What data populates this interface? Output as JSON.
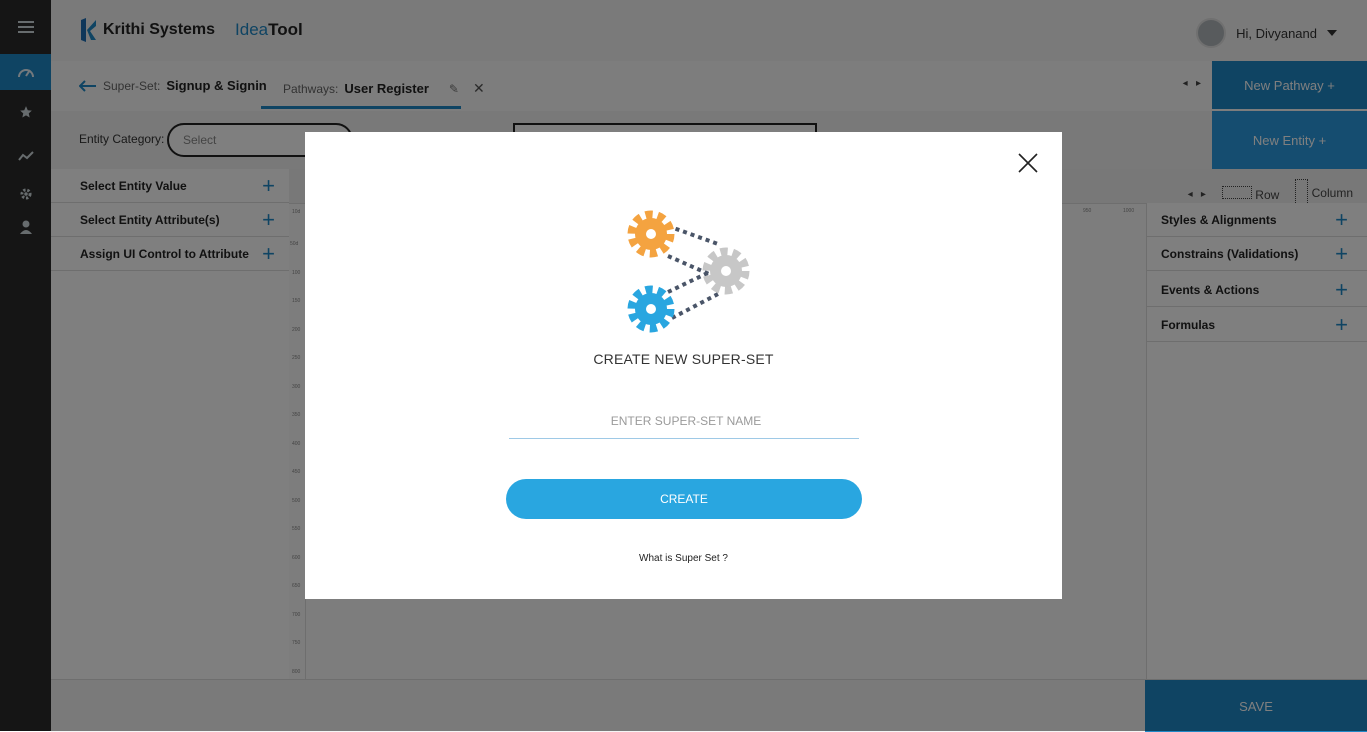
{
  "header": {
    "brand_name": "Krithi Systems",
    "idea_prefix": "Idea",
    "idea_suffix": "Tool",
    "user_greeting": "Hi, Divyanand"
  },
  "rail": {
    "items": [
      "menu-icon",
      "dashboard-icon",
      "star-icon",
      "chart-icon",
      "settings-icon",
      "user-icon"
    ]
  },
  "breadcrumb": {
    "label": "Super-Set:",
    "value": "Signup & Signin"
  },
  "pathways": {
    "label": "Pathways:",
    "value": "User Register"
  },
  "actions": {
    "new_pathway": "New Pathway  +",
    "new_entity": "New Entity +",
    "save": "SAVE"
  },
  "entity": {
    "category_label": "Entity Category:",
    "select_placeholder": "Select"
  },
  "left_panel": {
    "items": [
      "Select Entity Value",
      "Select Entity Attribute(s)",
      "Assign UI Control to Attribute"
    ]
  },
  "canvas_controls": {
    "row_label": "Row",
    "column_label": "Column"
  },
  "rulers": {
    "vertical": [
      "10d",
      "50d",
      "100",
      "150",
      "200",
      "250",
      "300",
      "350",
      "400",
      "450",
      "500",
      "550",
      "600",
      "650",
      "700",
      "750",
      "800"
    ],
    "horizontal": [
      "950",
      "1000"
    ]
  },
  "right_panel": {
    "items": [
      "Styles & Alignments",
      "Constrains (Validations)",
      "Events & Actions",
      "Formulas"
    ]
  },
  "modal": {
    "title": "CREATE NEW SUPER-SET",
    "input_placeholder": "ENTER SUPER-SET NAME",
    "input_value": "",
    "create_label": "CREATE",
    "help_link": "What is Super Set ?",
    "colors": {
      "orange_gear": "#f4a340",
      "gray_gear": "#c7c7c7",
      "blue_gear": "#29a6e0",
      "button": "#29a6e0"
    }
  }
}
